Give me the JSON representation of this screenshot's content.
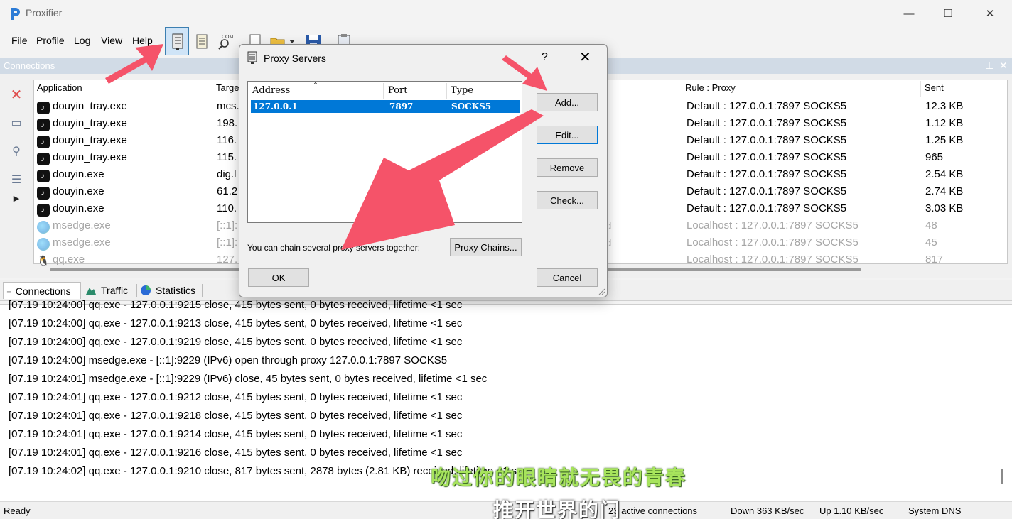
{
  "window": {
    "title": "Proxifier",
    "minimize": "—",
    "maximize": "☐",
    "close": "✕"
  },
  "menu": [
    "File",
    "Profile",
    "Log",
    "View",
    "Help"
  ],
  "toolbar_icons": [
    "proxy-servers-icon",
    "proxification-rules-icon",
    "name-resolution-icon",
    "open-profile-icon",
    "save-profile-icon",
    "clipboard-icon"
  ],
  "connections": {
    "header_title": "Connections",
    "columns": {
      "application": "Application",
      "target": "Targe",
      "rule": "Rule : Proxy",
      "sent": "Sent"
    },
    "rows": [
      {
        "app": "douyin_tray.exe",
        "target": "mcs.",
        "rule": "Default : 127.0.0.1:7897 SOCKS5",
        "sent": "12.3 KB",
        "icon": "douyin-icon",
        "dim": false
      },
      {
        "app": "douyin_tray.exe",
        "target": "198.",
        "rule": "Default : 127.0.0.1:7897 SOCKS5",
        "sent": "1.12 KB",
        "icon": "douyin-icon",
        "dim": false
      },
      {
        "app": "douyin_tray.exe",
        "target": "116.",
        "rule": "Default : 127.0.0.1:7897 SOCKS5",
        "sent": "1.25 KB",
        "icon": "douyin-icon",
        "dim": false
      },
      {
        "app": "douyin_tray.exe",
        "target": "115.",
        "rule": "Default : 127.0.0.1:7897 SOCKS5",
        "sent": "965",
        "icon": "douyin-icon",
        "dim": false
      },
      {
        "app": "douyin.exe",
        "target": "dig.l",
        "rule": "Default : 127.0.0.1:7897 SOCKS5",
        "sent": "2.54 KB",
        "icon": "douyin-icon",
        "dim": false
      },
      {
        "app": "douyin.exe",
        "target": "61.2",
        "rule": "Default : 127.0.0.1:7897 SOCKS5",
        "sent": "2.74 KB",
        "icon": "douyin-icon",
        "dim": false
      },
      {
        "app": "douyin.exe",
        "target": "110.",
        "rule": "Default : 127.0.0.1:7897 SOCKS5",
        "sent": "3.03 KB",
        "icon": "douyin-icon",
        "dim": false
      },
      {
        "app": "msedge.exe",
        "target": "[::1]:",
        "rule": "Localhost : 127.0.0.1:7897 SOCKS5",
        "sent": "48",
        "icon": "edge-icon",
        "dim": true
      },
      {
        "app": "msedge.exe",
        "target": "[::1]:",
        "rule": "Localhost : 127.0.0.1:7897 SOCKS5",
        "sent": "45",
        "icon": "edge-icon",
        "dim": true
      },
      {
        "app": "qq.exe",
        "target": "127.",
        "rule": "Localhost : 127.0.0.1:7897 SOCKS5",
        "sent": "817",
        "icon": "qq-icon",
        "dim": true
      }
    ],
    "hidden_col_fragment": "d"
  },
  "tabs": [
    {
      "label": "Connections",
      "icon": "connections-icon"
    },
    {
      "label": "Traffic",
      "icon": "traffic-icon"
    },
    {
      "label": "Statistics",
      "icon": "statistics-icon"
    }
  ],
  "log": [
    "[07.19 10:24:00] qq.exe - 127.0.0.1:9215 close, 415 bytes sent, 0 bytes received, lifetime <1 sec",
    "[07.19 10:24:00] qq.exe - 127.0.0.1:9213 close, 415 bytes sent, 0 bytes received, lifetime <1 sec",
    "[07.19 10:24:00] qq.exe - 127.0.0.1:9219 close, 415 bytes sent, 0 bytes received, lifetime <1 sec",
    "[07.19 10:24:00] msedge.exe - [::1]:9229 (IPv6) open through proxy 127.0.0.1:7897 SOCKS5",
    "[07.19 10:24:01] msedge.exe - [::1]:9229 (IPv6) close, 45 bytes sent, 0 bytes received, lifetime <1 sec",
    "[07.19 10:24:01] qq.exe - 127.0.0.1:9212 close, 415 bytes sent, 0 bytes received, lifetime <1 sec",
    "[07.19 10:24:01] qq.exe - 127.0.0.1:9218 close, 415 bytes sent, 0 bytes received, lifetime <1 sec",
    "[07.19 10:24:01] qq.exe - 127.0.0.1:9214 close, 415 bytes sent, 0 bytes received, lifetime <1 sec",
    "[07.19 10:24:01] qq.exe - 127.0.0.1:9216 close, 415 bytes sent, 0 bytes received, lifetime <1 sec",
    "[07.19 10:24:02] qq.exe - 127.0.0.1:9210 close, 817 bytes sent, 2878 bytes (2.81 KB) received, lifetime <1 sec"
  ],
  "status": {
    "ready": "Ready",
    "active": "23 active connections",
    "down": "Down 363 KB/sec",
    "up": "Up 1.10 KB/sec",
    "dns": "System DNS"
  },
  "dialog": {
    "title": "Proxy Servers",
    "help": "?",
    "close": "✕",
    "columns": {
      "address": "Address",
      "port": "Port",
      "type": "Type",
      "sort_glyph": "ˆ"
    },
    "rows": [
      {
        "address": "127.0.0.1",
        "port": "7897",
        "type": "SOCKS5"
      }
    ],
    "buttons": {
      "add": "Add...",
      "edit": "Edit...",
      "remove": "Remove",
      "check": "Check...",
      "proxy_chains": "Proxy Chains...",
      "ok": "OK",
      "cancel": "Cancel"
    },
    "chain_text": "You can chain several proxy servers together:"
  },
  "subtitles": {
    "line1": "吻过你的眼睛就无畏的青春",
    "line2": "推开世界的门"
  },
  "colors": {
    "accent": "#0078d7",
    "arrow": "#f55369",
    "header_bar": "#d1dbe6",
    "subtitle_green": "#a7e45c"
  }
}
